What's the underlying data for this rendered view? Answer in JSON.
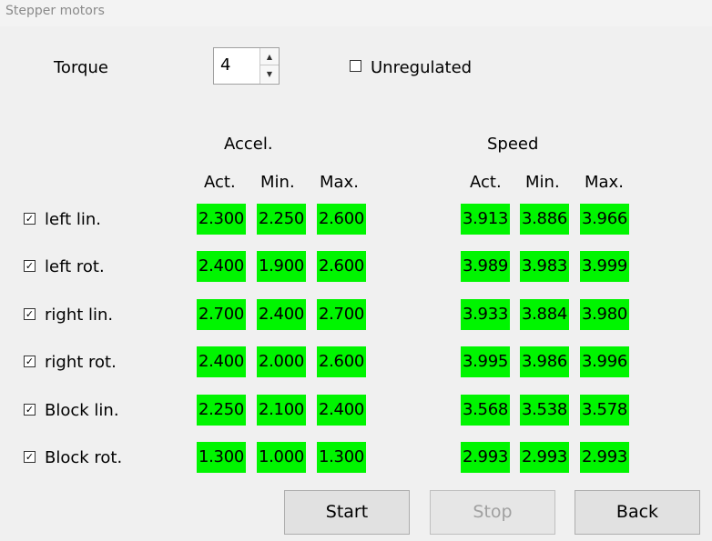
{
  "window": {
    "title": "Stepper motors"
  },
  "torque": {
    "label": "Torque",
    "value": "4",
    "up_glyph": "▲",
    "down_glyph": "▼"
  },
  "unregulated": {
    "label": "Unregulated",
    "checked": false
  },
  "groups": {
    "accel": "Accel.",
    "speed": "Speed"
  },
  "columns": [
    "Act.",
    "Min.",
    "Max.",
    "Act.",
    "Min.",
    "Max."
  ],
  "rows": [
    {
      "label": "left lin.",
      "checked": true,
      "accel": [
        "2.300",
        "2.250",
        "2.600"
      ],
      "speed": [
        "3.913",
        "3.886",
        "3.966"
      ]
    },
    {
      "label": "left rot.",
      "checked": true,
      "accel": [
        "2.400",
        "1.900",
        "2.600"
      ],
      "speed": [
        "3.989",
        "3.983",
        "3.999"
      ]
    },
    {
      "label": "right lin.",
      "checked": true,
      "accel": [
        "2.700",
        "2.400",
        "2.700"
      ],
      "speed": [
        "3.933",
        "3.884",
        "3.980"
      ]
    },
    {
      "label": "right rot.",
      "checked": true,
      "accel": [
        "2.400",
        "2.000",
        "2.600"
      ],
      "speed": [
        "3.995",
        "3.986",
        "3.996"
      ]
    },
    {
      "label": "Block lin.",
      "checked": true,
      "accel": [
        "2.250",
        "2.100",
        "2.400"
      ],
      "speed": [
        "3.568",
        "3.538",
        "3.578"
      ]
    },
    {
      "label": "Block rot.",
      "checked": true,
      "accel": [
        "1.300",
        "1.000",
        "1.300"
      ],
      "speed": [
        "2.993",
        "2.993",
        "2.993"
      ]
    }
  ],
  "check_glyph": "✓",
  "buttons": {
    "start": "Start",
    "stop": "Stop",
    "back": "Back"
  },
  "colors": {
    "value_bg": "#00f500",
    "disabled_text": "#a0a0a0"
  }
}
